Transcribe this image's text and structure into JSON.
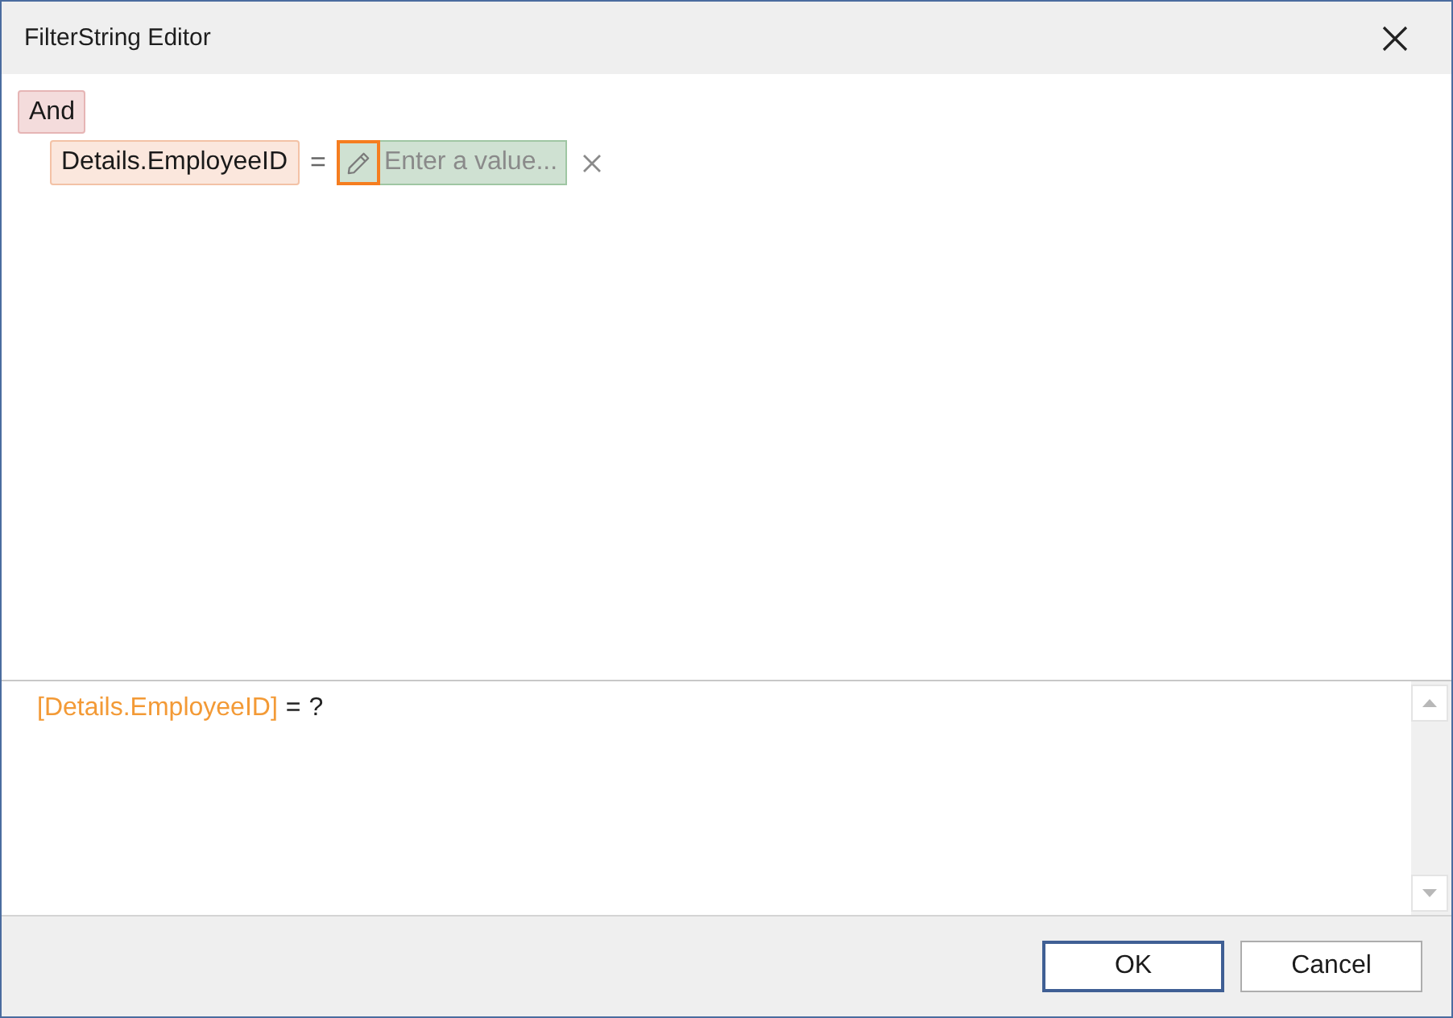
{
  "window": {
    "title": "FilterString Editor"
  },
  "tree": {
    "group": {
      "label": "And",
      "children": [
        {
          "field": "Details.EmployeeID",
          "operator": "=",
          "value": {
            "placeholder": "Enter a value...",
            "focused": true
          }
        }
      ]
    }
  },
  "expression": {
    "tokens": [
      {
        "kind": "field",
        "text": "[Details.EmployeeID]"
      },
      {
        "kind": "operator",
        "text": "="
      },
      {
        "kind": "parameter",
        "text": "?"
      }
    ]
  },
  "buttons": [
    {
      "label": "OK",
      "default": true
    },
    {
      "label": "Cancel",
      "default": false
    }
  ]
}
